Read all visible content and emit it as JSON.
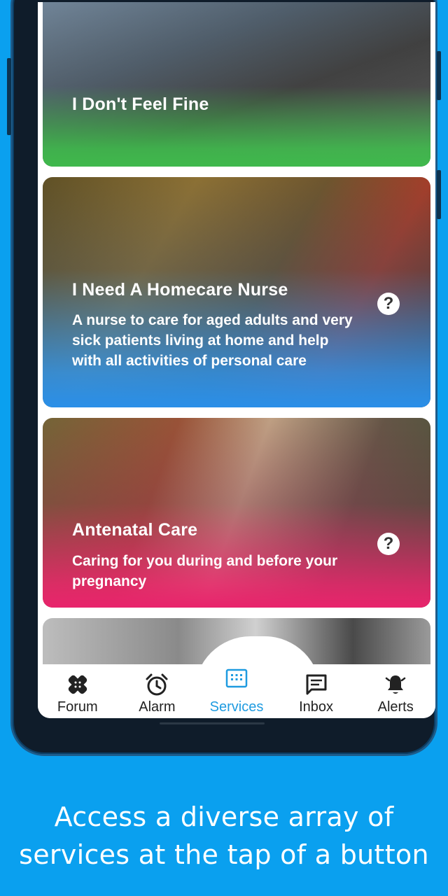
{
  "cards": [
    {
      "title": "I Don't Feel Fine",
      "description": "",
      "has_help": false,
      "accent": "#3fb94c"
    },
    {
      "title": "I Need A Homecare Nurse",
      "description": "A nurse to care for aged adults and very sick patients living at home and help with all activities of personal care",
      "has_help": true,
      "help_glyph": "?",
      "accent": "#2a8fe8"
    },
    {
      "title": "Antenatal Care",
      "description": "Caring for you during and before your pregnancy",
      "has_help": true,
      "help_glyph": "?",
      "accent": "#e8246c"
    }
  ],
  "nav": {
    "items": [
      {
        "label": "Forum",
        "icon": "bandage-icon",
        "active": false
      },
      {
        "label": "Alarm",
        "icon": "alarm-clock-icon",
        "active": false
      },
      {
        "label": "Services",
        "icon": "grid-icon",
        "active": true
      },
      {
        "label": "Inbox",
        "icon": "message-icon",
        "active": false
      },
      {
        "label": "Alerts",
        "icon": "bell-icon",
        "active": false
      }
    ],
    "active_color": "#1e9be0"
  },
  "tagline": {
    "line1": "Access a diverse array of",
    "line2": "services at the tap of a button"
  },
  "colors": {
    "background": "#0aa0ef"
  }
}
